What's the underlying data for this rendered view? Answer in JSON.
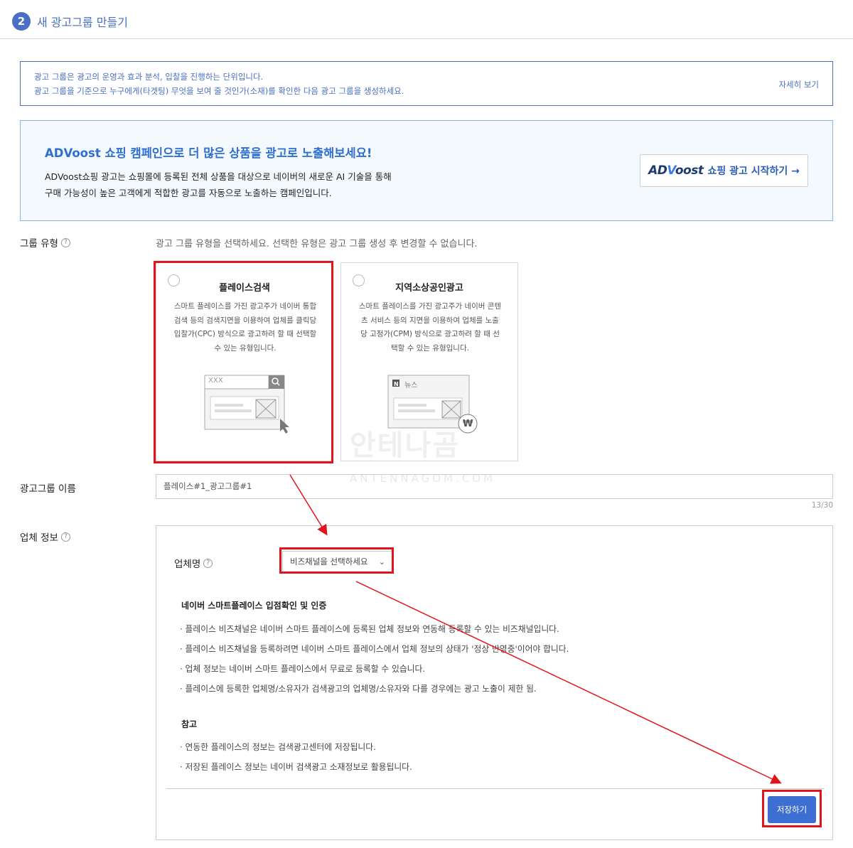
{
  "header": {
    "step": "2",
    "title": "새 광고그룹 만들기"
  },
  "info": {
    "line1": "광고 그룹은 광고의 운영과 효과 분석, 입찰을 진행하는 단위입니다.",
    "line2": "광고 그룹을 기준으로 누구에게(타겟팅) 무엇을 보여 줄 것인가(소재)를 확인한 다음 광고 그룹을 생성하세요.",
    "more_link": "자세히 보기"
  },
  "promo": {
    "title": "ADVoost 쇼핑 캠페인으로 더 많은 상품을 광고로 노출해보세요!",
    "desc1": "ADVoost쇼핑 광고는 쇼핑몰에 등록된 전체 상품을 대상으로 네이버의 새로운 AI 기술을 통해",
    "desc2": "구매 가능성이 높은 고객에게 적합한 광고를 자동으로 노출하는 캠페인입니다.",
    "logo_ad": "AD",
    "logo_v": "V",
    "logo_oost": "oost",
    "button_label": "쇼핑 광고 시작하기 →"
  },
  "group_type": {
    "label": "그룹 유형",
    "help": "?",
    "description": "광고 그룹 유형을 선택하세요. 선택한 유형은 광고 그룹 생성 후 변경할 수 없습니다.",
    "cards": [
      {
        "title": "플레이스검색",
        "desc": "스마트 플레이스를 가진 광고주가 네이버 통합검색 등의 검색지면을 이용하여 업체를 클릭당 입찰가(CPC) 방식으로 광고하려 할 때 선택할 수 있는 유형입니다.",
        "illust_text": "XXX"
      },
      {
        "title": "지역소상공인광고",
        "desc": "스마트 플레이스를 가진 광고주가 네이버 콘텐츠 서비스 등의 지면을 이용하여 업체를 노출당 고정가(CPM) 방식으로 광고하려 할 때 선택할 수 있는 유형입니다.",
        "illust_badge": "N",
        "illust_text": "뉴스",
        "illust_coin": "₩"
      }
    ]
  },
  "group_name": {
    "label": "광고그룹 이름",
    "value": "플레이스#1_광고그룹#1",
    "counter": "13/30"
  },
  "biz_info": {
    "label": "업체 정보",
    "help": "?",
    "biz_name_label": "업체명",
    "select_value": "비즈채널을 선택하세요",
    "section1_title": "네이버 스마트플레이스 입점확인 및 인증",
    "section1_items": [
      "· 플레이스 비즈채널은 네이버 스마트 플레이스에 등록된 업체 정보와 연동해 등록할 수 있는 비즈채널입니다.",
      "· 플레이스 비즈채널을 등록하려면 네이버 스마트 플레이스에서 업체 정보의 상태가 '정상 반영중'이어야 합니다.",
      "· 업체 정보는 네이버 스마트 플레이스에서 무료로 등록할 수 있습니다.",
      "· 플레이스에 등록한 업체명/소유자가 검색광고의 업체명/소유자와 다를 경우에는 광고 노출이 제한 됨."
    ],
    "section2_title": "참고",
    "section2_items": [
      "· 연동한 플레이스의 정보는 검색광고센터에 저장됩니다.",
      "· 저장된 플레이스 정보는 네이버 검색광고 소재정보로 활용됩니다."
    ],
    "save_label": "저장하기"
  },
  "watermark": {
    "main": "안테나곰",
    "sub": "ANTENNAGOM.COM"
  },
  "colors": {
    "accent": "#4a6fc4",
    "highlight": "#e0151c",
    "save": "#3c6fd1"
  }
}
